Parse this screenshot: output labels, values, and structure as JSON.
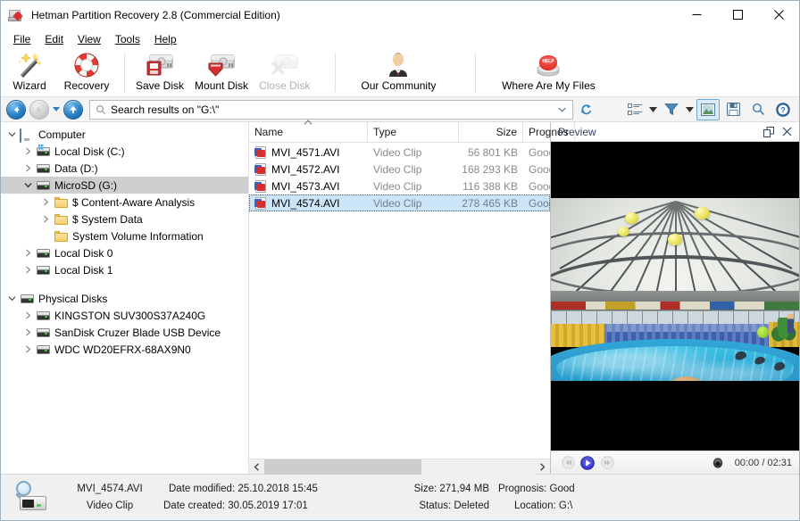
{
  "window": {
    "title": "Hetman Partition Recovery 2.8 (Commercial Edition)",
    "app_icon": "disk-recovery-icon",
    "minimize_label": "—",
    "maximize_label": "☐",
    "close_label": "✕"
  },
  "menu": {
    "items": [
      {
        "label": "File",
        "accel": "F"
      },
      {
        "label": "Edit",
        "accel": "E"
      },
      {
        "label": "View",
        "accel": "V"
      },
      {
        "label": "Tools",
        "accel": "T"
      },
      {
        "label": "Help",
        "accel": "H"
      }
    ]
  },
  "toolbar": {
    "buttons": [
      {
        "label": "Wizard",
        "icon": "magic-wand-icon",
        "disabled": false
      },
      {
        "label": "Recovery",
        "icon": "life-ring-icon",
        "disabled": false
      },
      {
        "label": "Save Disk",
        "icon": "save-disk-icon",
        "disabled": false
      },
      {
        "label": "Mount Disk",
        "icon": "mount-disk-icon",
        "disabled": false
      },
      {
        "label": "Close Disk",
        "icon": "close-disk-icon",
        "disabled": true
      },
      {
        "label": "Our Community",
        "icon": "person-icon",
        "disabled": false
      },
      {
        "label": "Where Are My Files",
        "icon": "help-button-icon",
        "disabled": false
      }
    ]
  },
  "navigation": {
    "back": "back-arrow",
    "forward": "forward-arrow",
    "history": "history-dropdown",
    "up": "up-arrow",
    "address_value": "Search results on \"G:\\\"",
    "address_icon": "search-icon",
    "address_caret": "chevron-down-icon",
    "refresh": "refresh-icon"
  },
  "view_toolbar": {
    "buttons": [
      {
        "name": "view-mode",
        "icon": "list-view-icon",
        "active": false
      },
      {
        "name": "view-mode-dropdown",
        "icon": "chevron-down-icon",
        "active": false
      },
      {
        "name": "filter",
        "icon": "funnel-icon",
        "active": false
      },
      {
        "name": "filter-dropdown",
        "icon": "chevron-down-icon",
        "active": false
      },
      {
        "name": "preview-pane-toggle",
        "icon": "preview-image-icon",
        "active": true
      },
      {
        "name": "save",
        "icon": "floppy-disk-icon",
        "active": false
      },
      {
        "name": "find",
        "icon": "magnifier-icon",
        "active": false
      },
      {
        "name": "help",
        "icon": "question-mark-icon",
        "active": false
      }
    ]
  },
  "tree": {
    "groups": [
      {
        "root": {
          "label": "Computer",
          "icon": "computer-icon",
          "expanded": true,
          "level": 0,
          "selected": false
        },
        "items": [
          {
            "label": "Local Disk (C:)",
            "icon": "windows-disk-icon",
            "expanded": false,
            "level": 1,
            "selected": false
          },
          {
            "label": "Data (D:)",
            "icon": "disk-icon",
            "expanded": false,
            "level": 1,
            "selected": false
          },
          {
            "label": "MicroSD (G:)",
            "icon": "disk-icon",
            "expanded": true,
            "level": 1,
            "selected": true
          },
          {
            "label": "$ Content-Aware Analysis",
            "icon": "folder-icon",
            "expanded": false,
            "level": 2,
            "selected": false
          },
          {
            "label": "$ System Data",
            "icon": "folder-icon",
            "expanded": false,
            "level": 2,
            "selected": false
          },
          {
            "label": "System Volume Information",
            "icon": "folder-icon",
            "expanded": null,
            "level": 2,
            "selected": false
          },
          {
            "label": "Local Disk 0",
            "icon": "disk-icon",
            "expanded": false,
            "level": 1,
            "selected": false
          },
          {
            "label": "Local Disk 1",
            "icon": "disk-icon",
            "expanded": false,
            "level": 1,
            "selected": false
          }
        ]
      },
      {
        "root": {
          "label": "Physical Disks",
          "icon": "disk-icon",
          "expanded": true,
          "level": 0,
          "selected": false
        },
        "items": [
          {
            "label": "KINGSTON SUV300S37A240G",
            "icon": "disk-icon",
            "expanded": false,
            "level": 1,
            "selected": false
          },
          {
            "label": "SanDisk Cruzer Blade USB Device",
            "icon": "disk-icon",
            "expanded": false,
            "level": 1,
            "selected": false
          },
          {
            "label": "WDC WD20EFRX-68AX9N0",
            "icon": "disk-icon",
            "expanded": false,
            "level": 1,
            "selected": false
          }
        ]
      }
    ]
  },
  "filelist": {
    "sort_column": "Name",
    "sort_direction": "ascending",
    "columns": [
      {
        "label": "Name",
        "align": "left"
      },
      {
        "label": "Type",
        "align": "left"
      },
      {
        "label": "Size",
        "align": "right"
      },
      {
        "label": "Prognos",
        "align": "left"
      }
    ],
    "rows": [
      {
        "name": "MVI_4571.AVI",
        "type": "Video Clip",
        "size": "56 801 KB",
        "prognosis": "Good",
        "icon": "avi-file-icon",
        "selected": false
      },
      {
        "name": "MVI_4572.AVI",
        "type": "Video Clip",
        "size": "168 293 KB",
        "prognosis": "Good",
        "icon": "avi-file-icon",
        "selected": false
      },
      {
        "name": "MVI_4573.AVI",
        "type": "Video Clip",
        "size": "116 388 KB",
        "prognosis": "Good",
        "icon": "avi-file-icon",
        "selected": false
      },
      {
        "name": "MVI_4574.AVI",
        "type": "Video Clip",
        "size": "278 465 KB",
        "prognosis": "Good",
        "icon": "avi-file-icon",
        "selected": true
      }
    ],
    "hscroll_left_arrow": "chevron-left-icon",
    "hscroll_right_arrow": "chevron-right-icon"
  },
  "preview": {
    "title": "Preview",
    "undock_icon": "undock-icon",
    "close_icon": "close-icon",
    "content_description": "Video frame: indoor dolphinarium with domed truss roof, yellow balloons, blue stadium seating and a circular blue pool with dolphins; a child's head in the foreground.",
    "controls": {
      "rewind": {
        "icon": "rewind-icon",
        "enabled": false
      },
      "play": {
        "icon": "play-icon",
        "enabled": true
      },
      "forward": {
        "icon": "fast-forward-icon",
        "enabled": false
      },
      "volume": {
        "icon": "volume-icon",
        "enabled": true
      },
      "time": "00:00 / 02:31"
    }
  },
  "statusbar": {
    "icon": "file-search-icon",
    "file_name": "MVI_4574.AVI",
    "file_type": "Video Clip",
    "date_modified": "Date modified: 25.10.2018 15:45",
    "date_created": "Date created: 30.05.2019 17:01",
    "size": "Size: 271,94 MB",
    "status": "Status: Deleted",
    "prognosis": "Prognosis: Good",
    "location": "Location: G:\\"
  },
  "colors": {
    "accent_blue": "#2a7fc4",
    "selection_blue": "#cce4f7",
    "tree_selection": "#cfcfcf",
    "chrome_bg": "#f0f0f0",
    "muted_text": "#8a8a8a"
  }
}
